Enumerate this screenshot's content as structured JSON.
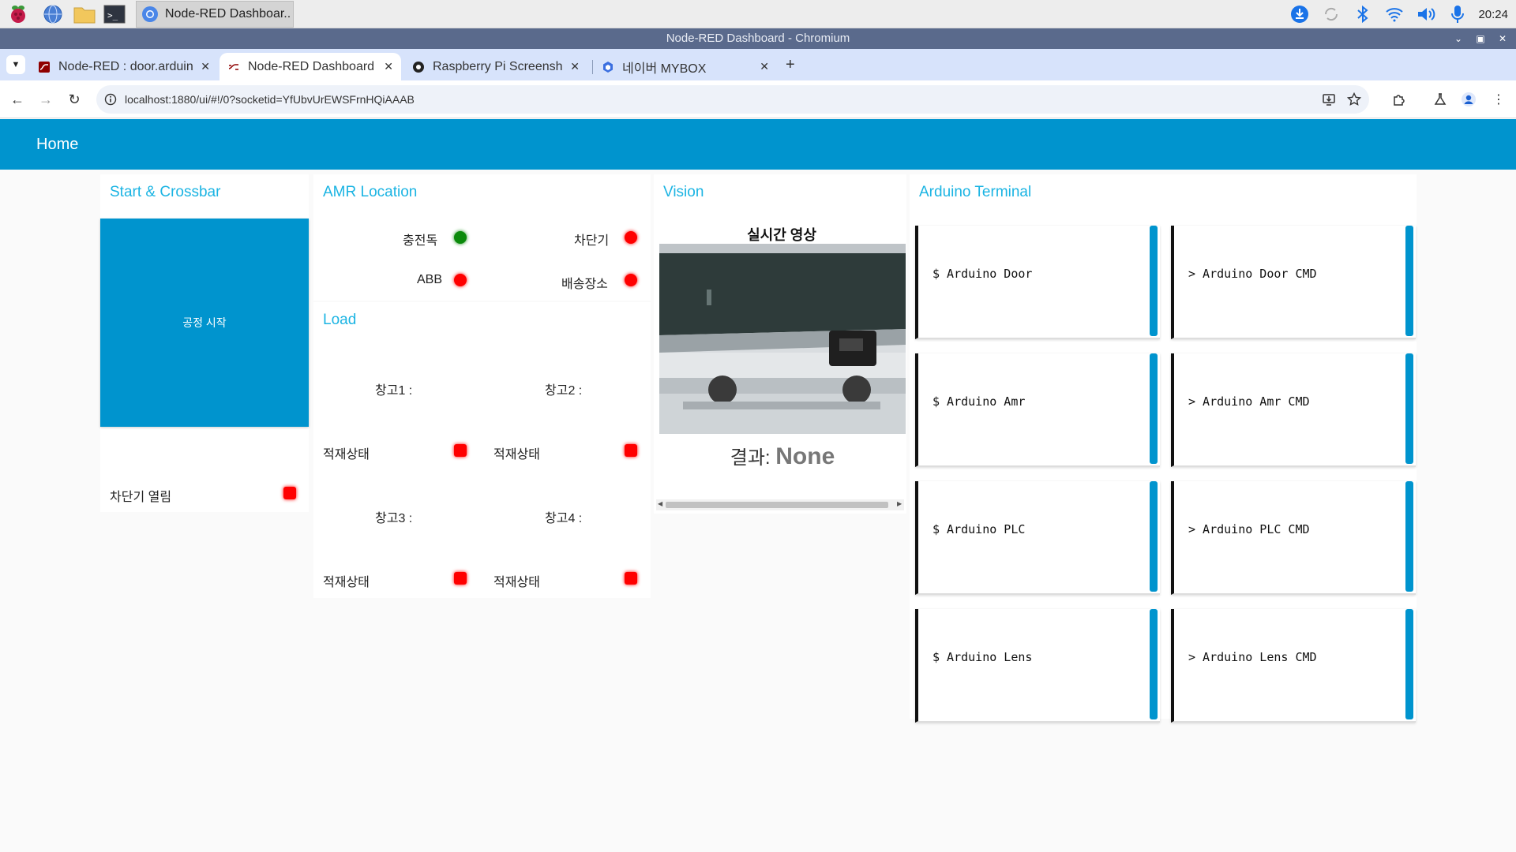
{
  "taskbar": {
    "active_task": "Node-RED Dashboar..",
    "clock": "20:24"
  },
  "window": {
    "title": "Node-RED Dashboard - Chromium"
  },
  "tabs": [
    {
      "title": "Node-RED : door.arduin",
      "active": false
    },
    {
      "title": "Node-RED Dashboard",
      "active": true
    },
    {
      "title": "Raspberry Pi Screensho",
      "active": false
    },
    {
      "title": "네이버 MYBOX",
      "active": false
    }
  ],
  "address": {
    "url": "localhost:1880/ui/#!/0?socketid=YfUbvUrEWSFrnHQiAAAB"
  },
  "dashboard": {
    "page_title": "Home",
    "start_card": {
      "title": "Start & Crossbar",
      "start_button": "공정 시작",
      "crossbar_label": "차단기 열림",
      "crossbar_color": "#ff0000"
    },
    "amr_card": {
      "title": "AMR Location",
      "items": [
        {
          "label": "충전독",
          "color": "#0b8a0b"
        },
        {
          "label": "차단기",
          "color": "#ff0000"
        },
        {
          "label": "ABB",
          "color": "#ff0000"
        },
        {
          "label": "배송장소",
          "color": "#ff0000"
        }
      ]
    },
    "load_card": {
      "title": "Load",
      "warehouses": [
        {
          "name": "창고1 :",
          "status_label": "적재상태",
          "color": "#ff0000"
        },
        {
          "name": "창고2 :",
          "status_label": "적재상태",
          "color": "#ff0000"
        },
        {
          "name": "창고3 :",
          "status_label": "적재상태",
          "color": "#ff0000"
        },
        {
          "name": "창고4 :",
          "status_label": "적재상태",
          "color": "#ff0000"
        }
      ]
    },
    "vision_card": {
      "title": "Vision",
      "caption": "실시간 영상",
      "result_label": "결과:",
      "result_value": "None"
    },
    "terminal_card": {
      "title": "Arduino Terminal",
      "terminals": [
        {
          "text": "$ Arduino Door"
        },
        {
          "text": "> Arduino Door CMD"
        },
        {
          "text": "$ Arduino Amr"
        },
        {
          "text": "> Arduino Amr CMD"
        },
        {
          "text": "$ Arduino PLC"
        },
        {
          "text": "> Arduino PLC CMD"
        },
        {
          "text": "$ Arduino Lens"
        },
        {
          "text": "> Arduino Lens CMD"
        }
      ]
    }
  }
}
